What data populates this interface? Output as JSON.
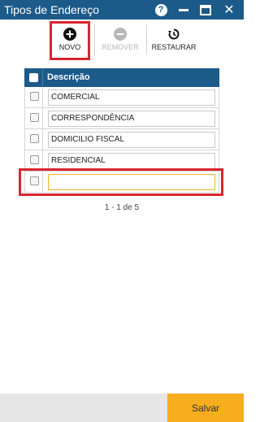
{
  "window": {
    "title": "Tipos de Endereço",
    "help_icon": "?",
    "close_icon": "✕"
  },
  "toolbar": {
    "novo": {
      "label": "NOVO",
      "icon": "plus-circle-icon"
    },
    "remover": {
      "label": "REMOVER",
      "icon": "minus-circle-icon",
      "enabled": false
    },
    "restaurar": {
      "label": "RESTAURAR",
      "icon": "restore-icon"
    }
  },
  "grid": {
    "header": {
      "label": "Descrição"
    },
    "rows": [
      {
        "value": "COMERCIAL"
      },
      {
        "value": "CORRESPONDÊNCIA"
      },
      {
        "value": "DOMICILIO FISCAL"
      },
      {
        "value": "RESIDENCIAL"
      },
      {
        "value": ""
      }
    ]
  },
  "pager": {
    "text": "1 - 1 de 5"
  },
  "footer": {
    "save_label": "Salvar"
  },
  "colors": {
    "titlebar": "#1c5a8a",
    "highlight": "#d8262f",
    "save_button": "#f6ad1e"
  }
}
